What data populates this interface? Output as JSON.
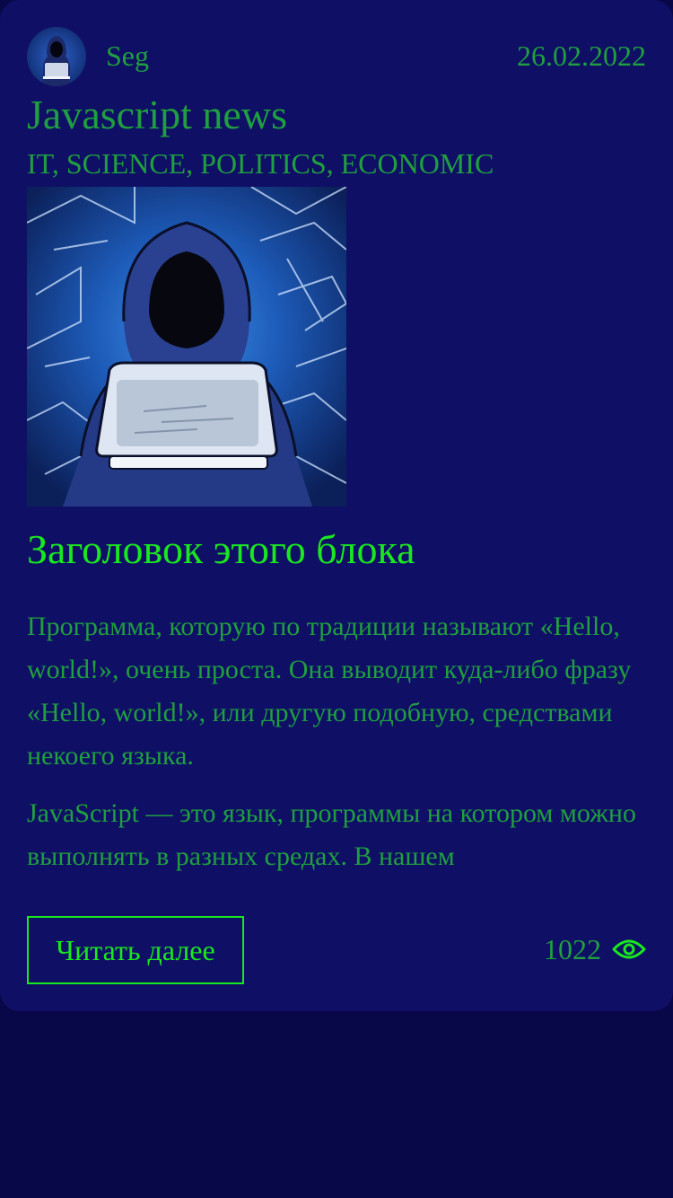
{
  "post": {
    "author": "Seg",
    "date": "26.02.2022",
    "title": "Javascript news",
    "tags": "IT, SCIENCE, POLITICS, ECONOMIC",
    "block_heading": "Заголовок этого блока",
    "paragraphs": [
      "Программа, которую по традиции называют «Hello, world!», очень проста. Она выводит куда-либо фразу «Hello, world!», или другую подобную, средствами некоего языка.",
      "JavaScript — это язык, программы на котором можно выполнять в разных средах. В нашем"
    ],
    "read_more_label": "Читать далее",
    "views": "1022"
  },
  "icons": {
    "views": "eye-icon",
    "avatar": "hacker-avatar",
    "hero": "hooded-hacker-laptop-image"
  },
  "colors": {
    "page_background": "#080747",
    "card_background": "#0f0f66",
    "text_green": "#1f9f3f",
    "accent_green": "#19e81f"
  }
}
